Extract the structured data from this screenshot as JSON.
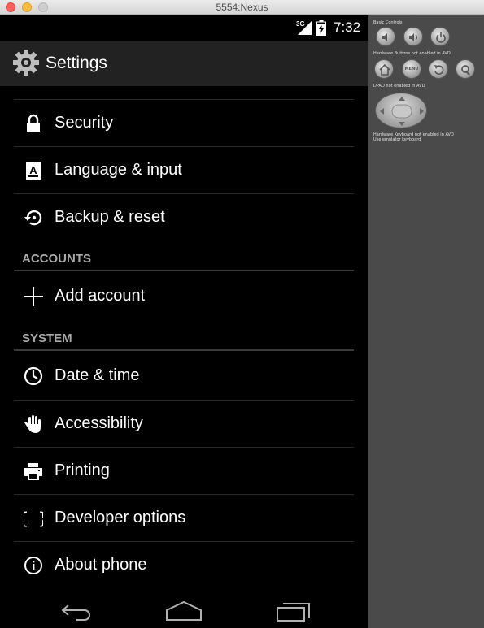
{
  "window": {
    "title": "5554:Nexus"
  },
  "status_bar": {
    "network": "3G",
    "time": "7:32"
  },
  "action_bar": {
    "title": "Settings",
    "icon": "gear-icon"
  },
  "settings": {
    "items_top": [
      {
        "label": "Security",
        "icon": "lock-icon"
      },
      {
        "label": "Language & input",
        "icon": "keyboard-a-icon"
      },
      {
        "label": "Backup & reset",
        "icon": "backup-restore-icon"
      }
    ],
    "accounts_header": "ACCOUNTS",
    "accounts_items": [
      {
        "label": "Add account",
        "icon": "plus-icon"
      }
    ],
    "system_header": "SYSTEM",
    "system_items": [
      {
        "label": "Date & time",
        "icon": "clock-icon"
      },
      {
        "label": "Accessibility",
        "icon": "hand-icon"
      },
      {
        "label": "Printing",
        "icon": "printer-icon"
      },
      {
        "label": "Developer options",
        "icon": "braces-icon"
      },
      {
        "label": "About phone",
        "icon": "info-icon"
      }
    ]
  },
  "nav_bar": {
    "buttons": [
      "back-icon",
      "home-icon",
      "recents-icon"
    ]
  },
  "emulator_panel": {
    "basic_controls": "Basic Controls",
    "hardware_buttons": "Hardware Buttons not enabled in AVD",
    "dpad": "DPAD not enabled in AVD",
    "keyboard_line1": "Hardware Keyboard not enabled in AVD",
    "keyboard_line2": "Use emulator keyboard",
    "menu_label": "MENU"
  }
}
